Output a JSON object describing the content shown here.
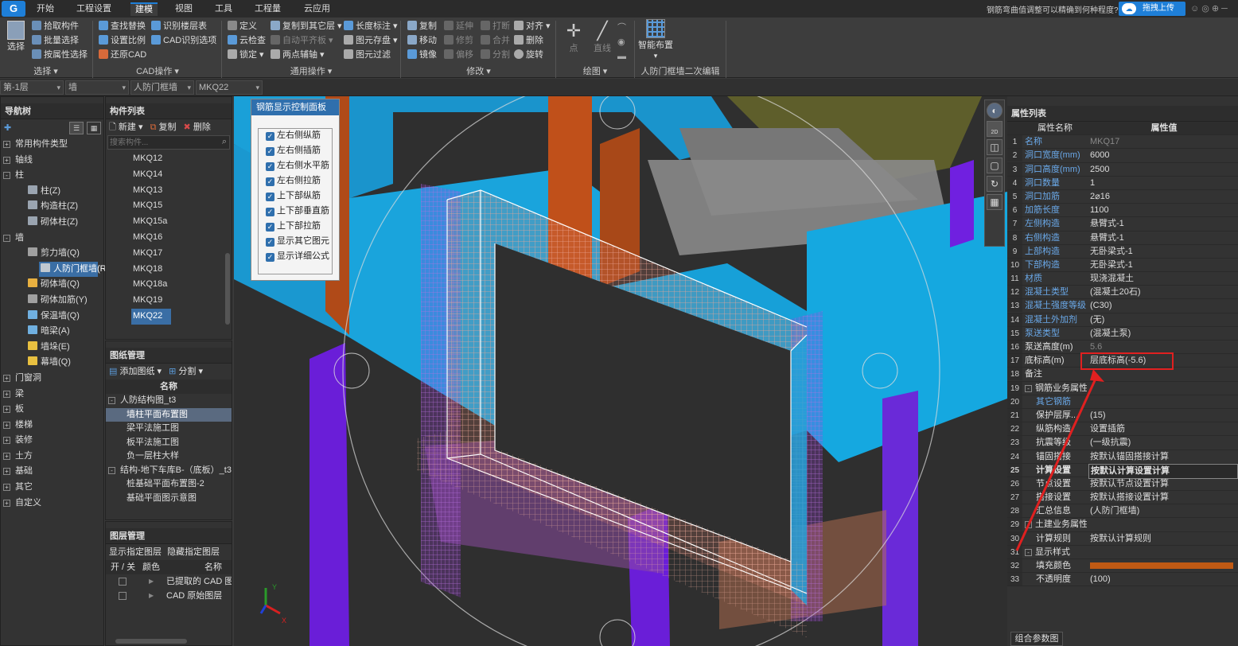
{
  "app": {
    "menu_tabs": [
      "开始",
      "工程设置",
      "建模",
      "视图",
      "工具",
      "工程量",
      "云应用"
    ],
    "active_tab": "建模",
    "help_text": "钢筋弯曲值调整可以精确到何种程度?",
    "upload_button": "拖拽上传",
    "accent_color": "#1e7fd8"
  },
  "ribbon": {
    "select": {
      "big_button": "选择",
      "items": [
        "拾取构件",
        "批量选择",
        "按属性选择"
      ],
      "group": "选择"
    },
    "cad": {
      "items": [
        "查找替换",
        "识别楼层表",
        "设置比例",
        "CAD识别选项",
        "还原CAD"
      ],
      "group": "CAD操作"
    },
    "general": {
      "items": [
        "定义",
        "复制到其它层",
        "长度标注",
        "云检查",
        "自动平齐板",
        "图元存盘",
        "锁定",
        "两点辅轴",
        "图元过滤"
      ],
      "group": "通用操作"
    },
    "modify": {
      "items": [
        "复制",
        "延伸",
        "打断",
        "对齐",
        "移动",
        "修剪",
        "合并",
        "删除",
        "镜像",
        "偏移",
        "分割",
        "旋转"
      ],
      "group": "修改"
    },
    "draw": {
      "items": [
        "点",
        "直线"
      ],
      "group": "绘图"
    },
    "smart": {
      "label": "智能布置",
      "group": "人防门框墙二次编辑"
    }
  },
  "selectors": {
    "floor": "第-1层",
    "category": "墙",
    "type": "人防门框墙",
    "component": "MKQ22"
  },
  "nav_tree": {
    "title": "导航树",
    "items": [
      {
        "label": "常用构件类型",
        "level": 0,
        "expander": "+"
      },
      {
        "label": "轴线",
        "level": 0,
        "expander": "+"
      },
      {
        "label": "柱",
        "level": 0,
        "expander": "-"
      },
      {
        "label": "柱(Z)",
        "level": 1,
        "color": "#9aa4b0"
      },
      {
        "label": "构造柱(Z)",
        "level": 1,
        "color": "#9aa4b0"
      },
      {
        "label": "砌体柱(Z)",
        "level": 1,
        "color": "#9aa4b0"
      },
      {
        "label": "墙",
        "level": 0,
        "expander": "-"
      },
      {
        "label": "剪力墙(Q)",
        "level": 1,
        "color": "#a0a0a0"
      },
      {
        "label": "人防门框墙(RF)",
        "level": 1,
        "color": "#c0c8d0",
        "selected": true
      },
      {
        "label": "砌体墙(Q)",
        "level": 1,
        "color": "#e8b040"
      },
      {
        "label": "砌体加筋(Y)",
        "level": 1,
        "color": "#a0a0a0"
      },
      {
        "label": "保温墙(Q)",
        "level": 1,
        "color": "#70b0e0"
      },
      {
        "label": "暗梁(A)",
        "level": 1,
        "color": "#70b0e0"
      },
      {
        "label": "墙垛(E)",
        "level": 1,
        "color": "#e8c040"
      },
      {
        "label": "幕墙(Q)",
        "level": 1,
        "color": "#e8c040"
      },
      {
        "label": "门窗洞",
        "level": 0,
        "expander": "+"
      },
      {
        "label": "梁",
        "level": 0,
        "expander": "+"
      },
      {
        "label": "板",
        "level": 0,
        "expander": "+"
      },
      {
        "label": "楼梯",
        "level": 0,
        "expander": "+"
      },
      {
        "label": "装修",
        "level": 0,
        "expander": "+"
      },
      {
        "label": "土方",
        "level": 0,
        "expander": "+"
      },
      {
        "label": "基础",
        "level": 0,
        "expander": "+"
      },
      {
        "label": "其它",
        "level": 0,
        "expander": "+"
      },
      {
        "label": "自定义",
        "level": 0,
        "expander": "+"
      }
    ]
  },
  "component_list": {
    "title": "构件列表",
    "new": "新建",
    "copy": "复制",
    "delete": "删除",
    "search_placeholder": "搜索构件...",
    "items": [
      "MKQ12",
      "MKQ14",
      "MKQ13",
      "MKQ15",
      "MKQ15a",
      "MKQ16",
      "MKQ17",
      "MKQ18",
      "MKQ18a",
      "MKQ19",
      "MKQ22"
    ],
    "selected": "MKQ22"
  },
  "drawing_mgmt": {
    "title": "图纸管理",
    "add": "添加图纸",
    "split": "分割",
    "column": "名称",
    "items": [
      {
        "label": "人防结构图_t3",
        "level": 0,
        "expander": "-"
      },
      {
        "label": "墙柱平面布置图",
        "level": 1,
        "selected": true
      },
      {
        "label": "梁平法施工图",
        "level": 1
      },
      {
        "label": "板平法施工图",
        "level": 1
      },
      {
        "label": "负一层柱大样",
        "level": 1
      },
      {
        "label": "结构-地下车库B-（底板）_t3",
        "level": 0,
        "expander": "-"
      },
      {
        "label": "桩基础平面布置图-2",
        "level": 1
      },
      {
        "label": "基础平面图示意图",
        "level": 1
      }
    ]
  },
  "layer_mgmt": {
    "title": "图层管理",
    "show_specified": "显示指定图层",
    "hide_specified": "隐藏指定图层",
    "col_toggle": "开 / 关",
    "col_color": "颜色",
    "col_name": "名称",
    "rows": [
      "已提取的 CAD 图层",
      "CAD 原始图层"
    ]
  },
  "rebar_panel": {
    "title": "钢筋显示控制面板",
    "options": [
      "左右侧纵筋",
      "左右侧插筋",
      "左右侧水平筋",
      "左右侧拉筋",
      "上下部纵筋",
      "上下部垂直筋",
      "上下部拉筋",
      "显示其它图元",
      "显示详细公式"
    ]
  },
  "properties": {
    "title": "属性列表",
    "col_name": "属性名称",
    "col_value": "属性值",
    "rows": [
      {
        "n": "1",
        "name": "名称",
        "value": "MKQ17",
        "blue": true,
        "grey": true
      },
      {
        "n": "2",
        "name": "洞口宽度(mm)",
        "value": "6000",
        "blue": true
      },
      {
        "n": "3",
        "name": "洞口高度(mm)",
        "value": "2500",
        "blue": true
      },
      {
        "n": "4",
        "name": "洞口数量",
        "value": "1",
        "blue": true
      },
      {
        "n": "5",
        "name": "洞口加筋",
        "value": "2⌀16",
        "blue": true
      },
      {
        "n": "6",
        "name": "加筋长度",
        "value": "1100",
        "blue": true
      },
      {
        "n": "7",
        "name": "左侧构造",
        "value": "悬臂式-1",
        "blue": true
      },
      {
        "n": "8",
        "name": "右侧构造",
        "value": "悬臂式-1",
        "blue": true
      },
      {
        "n": "9",
        "name": "上部构造",
        "value": "无卧梁式-1",
        "blue": true
      },
      {
        "n": "10",
        "name": "下部构造",
        "value": "无卧梁式-1",
        "blue": true
      },
      {
        "n": "11",
        "name": "材质",
        "value": "现浇混凝土",
        "blue": true
      },
      {
        "n": "12",
        "name": "混凝土类型",
        "value": "(混凝土20石)",
        "blue": true
      },
      {
        "n": "13",
        "name": "混凝土强度等级",
        "value": "(C30)",
        "blue": true
      },
      {
        "n": "14",
        "name": "混凝土外加剂",
        "value": "(无)",
        "blue": true
      },
      {
        "n": "15",
        "name": "泵送类型",
        "value": "(混凝土泵)",
        "blue": true
      },
      {
        "n": "16",
        "name": "泵送高度(m)",
        "value": "5.6",
        "grey": true
      },
      {
        "n": "17",
        "name": "底标高(m)",
        "value": "层底标高(-5.6)",
        "highlight": true
      },
      {
        "n": "18",
        "name": "备注",
        "value": ""
      },
      {
        "n": "19",
        "name": "钢筋业务属性",
        "value": "",
        "group": true
      },
      {
        "n": "20",
        "name": "其它钢筋",
        "value": "",
        "blue": true,
        "indent": true
      },
      {
        "n": "21",
        "name": "保护层厚...",
        "value": "(15)",
        "indent": true
      },
      {
        "n": "22",
        "name": "纵筋构造",
        "value": "设置插筋",
        "indent": true
      },
      {
        "n": "23",
        "name": "抗震等级",
        "value": "(一级抗震)",
        "indent": true
      },
      {
        "n": "24",
        "name": "锚固搭接",
        "value": "按默认锚固搭接计算",
        "indent": true
      },
      {
        "n": "25",
        "name": "计算设置",
        "value": "按默认计算设置计算",
        "indent": true,
        "bold": true
      },
      {
        "n": "26",
        "name": "节点设置",
        "value": "按默认节点设置计算",
        "indent": true
      },
      {
        "n": "27",
        "name": "搭接设置",
        "value": "按默认搭接设置计算",
        "indent": true
      },
      {
        "n": "28",
        "name": "汇总信息",
        "value": "(人防门框墙)",
        "indent": true
      },
      {
        "n": "29",
        "name": "土建业务属性",
        "value": "",
        "group": true
      },
      {
        "n": "30",
        "name": "计算规则",
        "value": "按默认计算规则",
        "indent": true
      },
      {
        "n": "31",
        "name": "显示样式",
        "value": "",
        "group": true
      },
      {
        "n": "32",
        "name": "填充颜色",
        "value": "",
        "indent": true,
        "swatch": "#c05a14"
      },
      {
        "n": "33",
        "name": "不透明度",
        "value": "(100)",
        "indent": true
      }
    ],
    "bottom_tab": "组合参数图"
  },
  "viewcube": {
    "zoom_label": "2D"
  }
}
